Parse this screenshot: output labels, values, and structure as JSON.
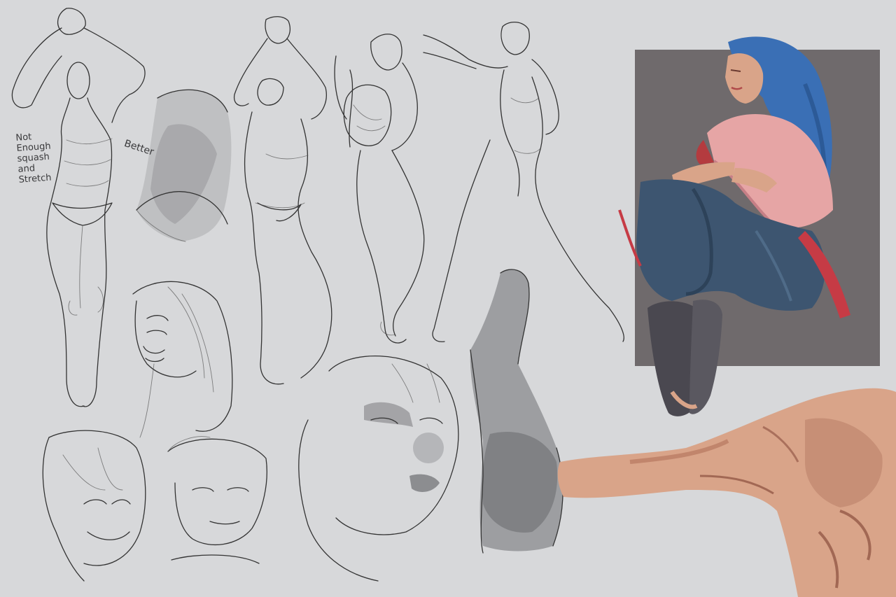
{
  "annotations": {
    "left_note": [
      "Not",
      "Enough",
      "squash",
      "and",
      "Stretch"
    ],
    "right_note": "Better"
  },
  "colors": {
    "paper": "#d7d8da",
    "panel": "#6f6a6c",
    "hair": "#3a6fb5",
    "jacket": "#e6a5a5",
    "jeans": "#3d5570",
    "skin": "#d9a489",
    "pencil": "#333333"
  }
}
